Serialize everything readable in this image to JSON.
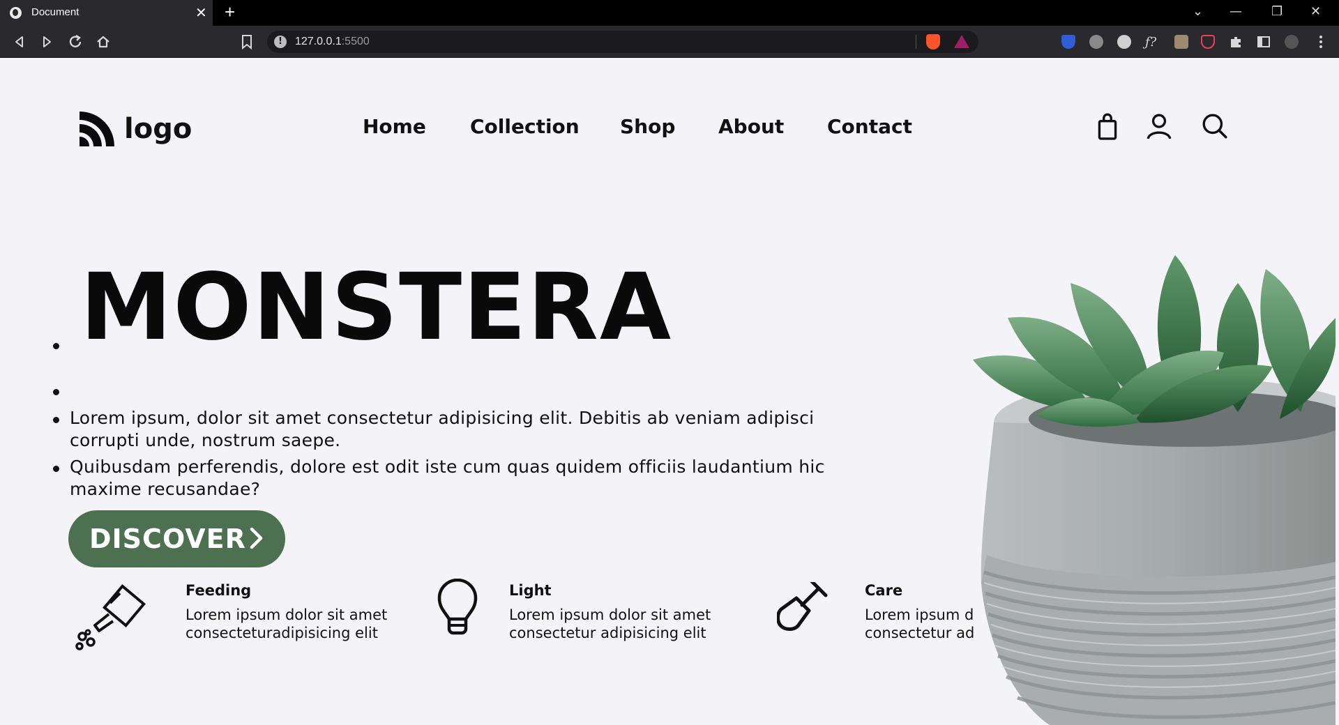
{
  "browser": {
    "tab_title": "Document",
    "tab_close": "✕",
    "new_tab": "+",
    "url_host": "127.0.0.1",
    "url_port": ":5500",
    "window_controls": [
      "⌄",
      "—",
      "❐",
      "✕"
    ]
  },
  "logo": {
    "text": "logo"
  },
  "nav": {
    "items": [
      "Home",
      "Collection",
      "Shop",
      "About",
      "Contact"
    ]
  },
  "header_icons": [
    "bag-icon",
    "user-icon",
    "search-icon"
  ],
  "hero": {
    "title": "MONSTERA",
    "paragraph1": "Lorem ipsum, dolor sit amet consectetur adipisicing elit. Debitis ab veniam adipisci corrupti unde, nostrum saepe.",
    "paragraph2": "Quibusdam perferendis, dolore est odit iste cum quas quidem officiis laudantium hic maxime recusandae?",
    "cta_label": "DISCOVER",
    "cta_color": "#4d7050"
  },
  "features": [
    {
      "name": "Feeding",
      "line1": "Lorem ipsum dolor sit amet",
      "line2": "consecteturadipisicing elit",
      "icon": "watering-can-icon"
    },
    {
      "name": "Light",
      "line1": "Lorem ipsum dolor sit amet",
      "line2": "consectetur adipisicing elit",
      "icon": "light-bulb-icon"
    },
    {
      "name": "Care",
      "line1": "Lorem ipsum do",
      "line2": "consectetur adi",
      "icon": "shovel-icon"
    }
  ]
}
